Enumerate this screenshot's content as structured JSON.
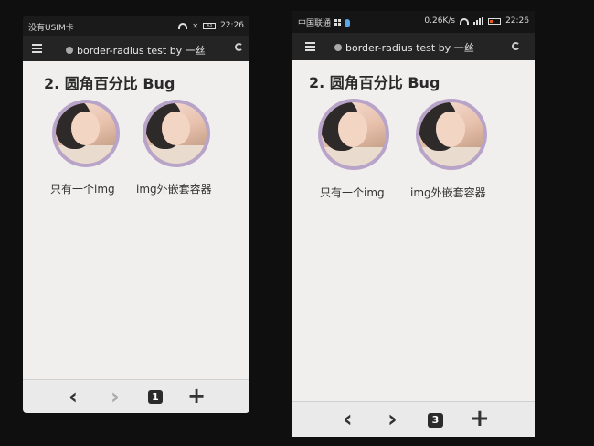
{
  "left": {
    "status": {
      "carrier": "没有USIM卡",
      "battery_text": "43",
      "time": "22:26"
    },
    "browser": {
      "title": "border-radius test by 一丝"
    },
    "page": {
      "heading": "2. 圆角百分比 Bug",
      "items": [
        {
          "caption": "只有一个img"
        },
        {
          "caption": "img外嵌套容器"
        }
      ]
    },
    "toolbar": {
      "back": "‹",
      "forward": "›",
      "tab_count": "1",
      "new_tab": "+"
    }
  },
  "right": {
    "status": {
      "carrier": "中国联通",
      "speed": "0.26K/s",
      "time": "22:26"
    },
    "browser": {
      "title": "border-radius test by 一丝"
    },
    "page": {
      "heading": "2. 圆角百分比 Bug",
      "items": [
        {
          "caption": "只有一个img"
        },
        {
          "caption": "img外嵌套容器"
        }
      ]
    },
    "toolbar": {
      "back": "‹",
      "forward": "›",
      "tab_count": "3",
      "new_tab": "+"
    }
  },
  "colors": {
    "avatar_ring": "#b9a4c9",
    "page_bg": "#f1efee",
    "battery_low": "#e35a1e"
  }
}
